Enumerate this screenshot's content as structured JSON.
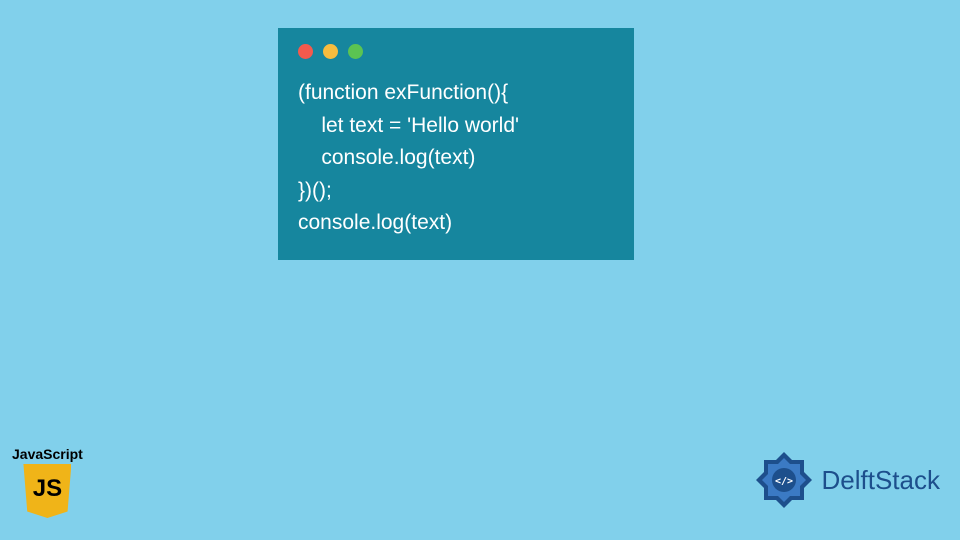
{
  "code": {
    "line1": "(function exFunction(){",
    "line2": "    let text = 'Hello world'",
    "line3": "    console.log(text)",
    "line4": "})();",
    "line5": "console.log(text)"
  },
  "jsBadge": {
    "label": "JavaScript",
    "shield": "JS"
  },
  "brand": {
    "name": "DelftStack"
  }
}
